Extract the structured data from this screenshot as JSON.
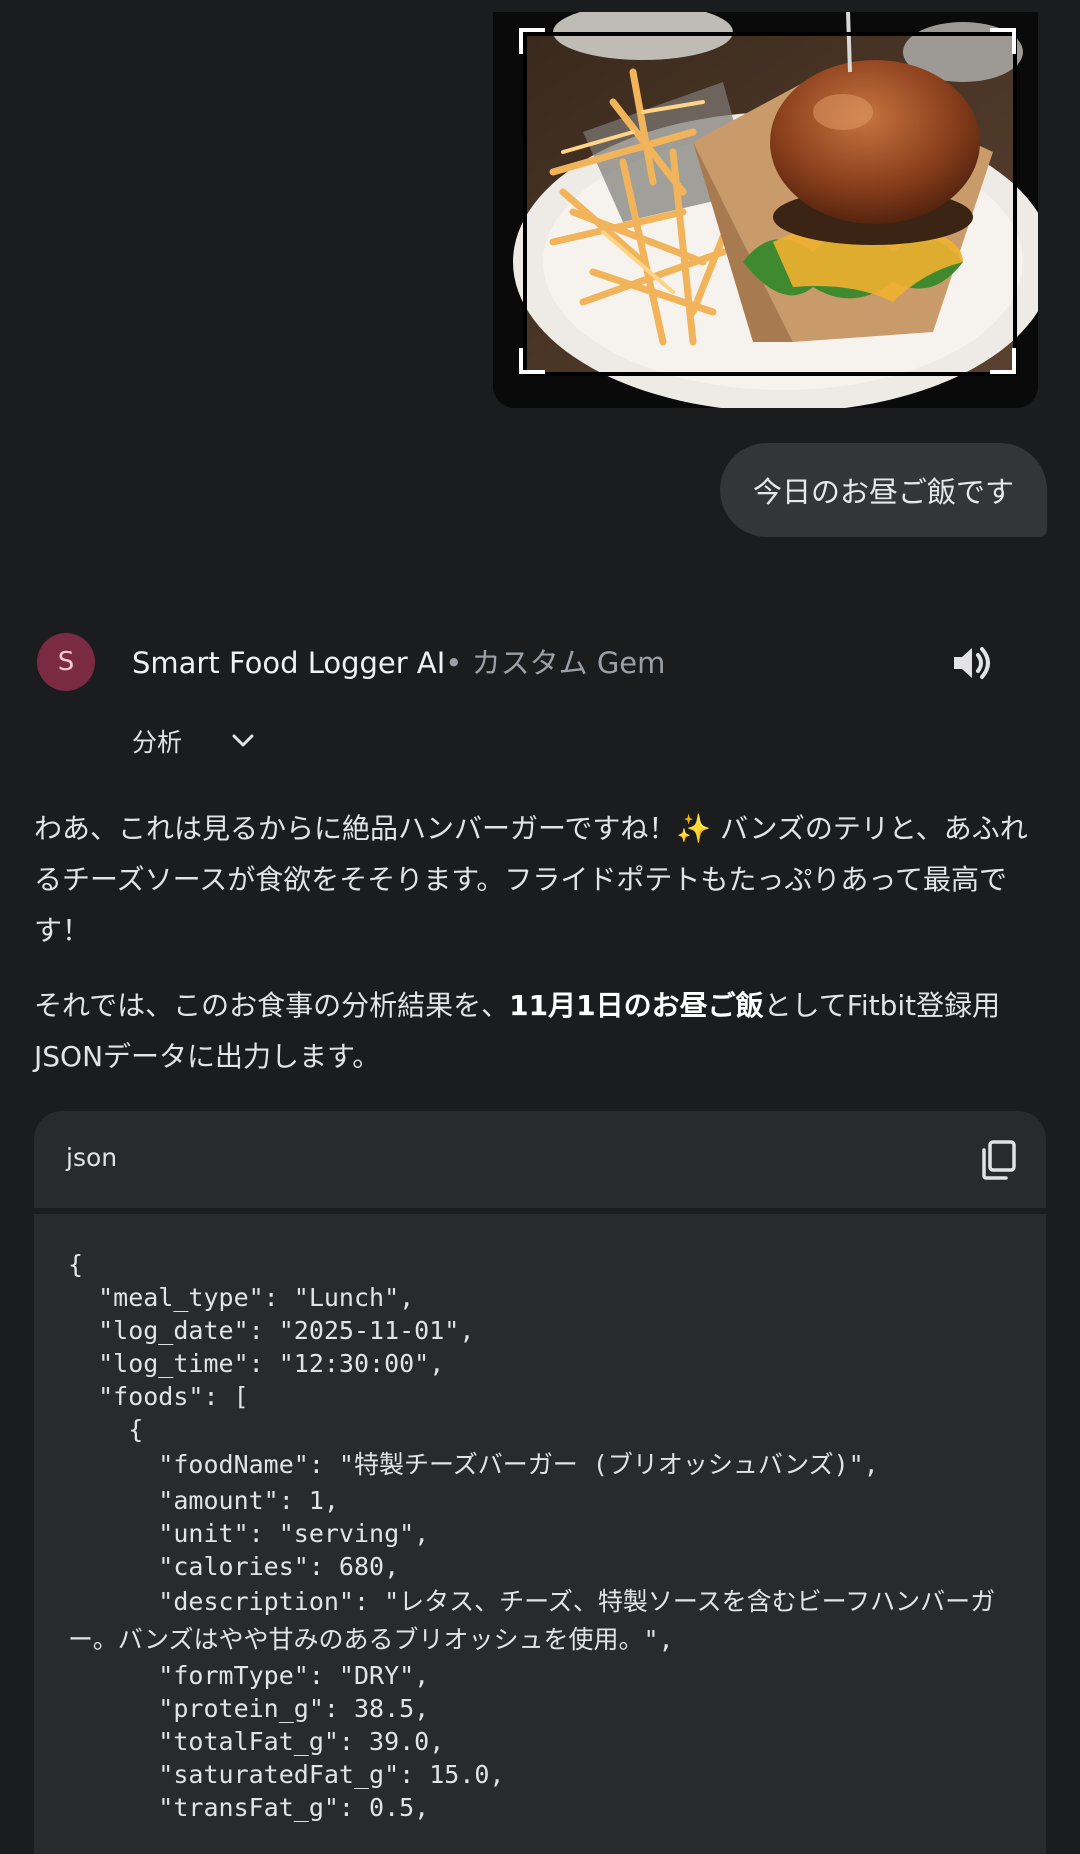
{
  "user_message": {
    "text": "今日のお昼ご飯です"
  },
  "gem": {
    "avatar_letter": "S",
    "name": "Smart Food Logger AI",
    "tag": "• カスタム Gem",
    "analysis_label": "分析"
  },
  "response": {
    "paragraph1": "わあ、これは見るからに絶品ハンバーガーですね！✨ バンズのテリと、あふれるチーズソースが食欲をそそります。フライドポテトもたっぷりあって最高です！",
    "p2_before": "それでは、このお食事の分析結果を、",
    "p2_bold": "11月1日のお昼ご飯",
    "p2_after": "としてFitbit登録用JSONデータに出力します。"
  },
  "code": {
    "language": "json",
    "lines": [
      "{",
      "  \"meal_type\": \"Lunch\",",
      "  \"log_date\": \"2025-11-01\",",
      "  \"log_time\": \"12:30:00\",",
      "  \"foods\": [",
      "    {",
      "      \"foodName\": \"特製チーズバーガー (ブリオッシュバンズ)\",",
      "      \"amount\": 1,",
      "      \"unit\": \"serving\",",
      "      \"calories\": 680,",
      "      \"description\": \"レタス、チーズ、特製ソースを含むビーフハンバーガ",
      "ー。バンズはやや甘みのあるブリオッシュを使用。\",",
      "      \"formType\": \"DRY\",",
      "      \"protein_g\": 38.5,",
      "      \"totalFat_g\": 39.0,",
      "      \"saturatedFat_g\": 15.0,",
      "      \"transFat_g\": 0.5,"
    ]
  },
  "icons": {
    "speaker": "speaker-icon",
    "chevron": "chevron-down-icon",
    "copy": "copy-icon"
  },
  "colors": {
    "background": "#1b1c1e",
    "bubble": "#333537",
    "code_background": "#282a2c",
    "avatar": "#7b2a44"
  }
}
